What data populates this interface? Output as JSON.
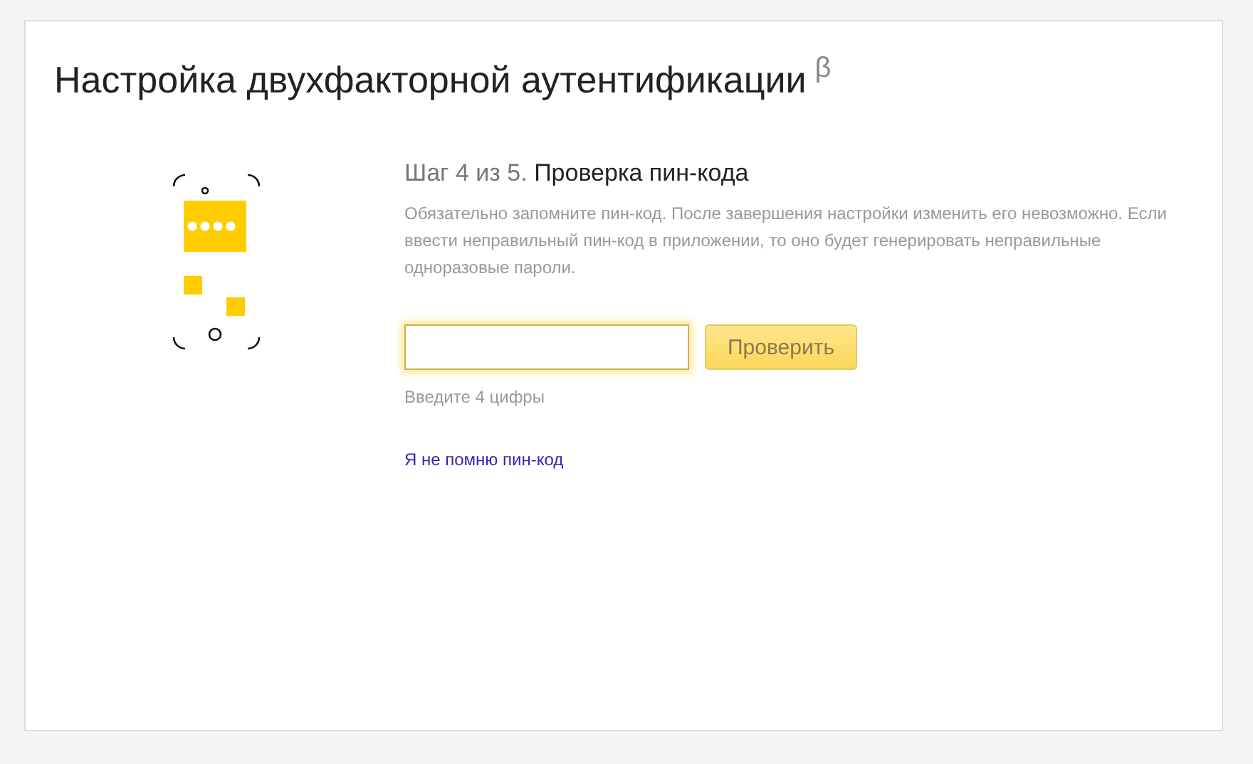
{
  "title": "Настройка двухфакторной аутентификации",
  "title_mark": "β",
  "step": {
    "number": "Шаг 4 из 5.",
    "name": "Проверка пин-кода"
  },
  "description": "Обязательно запомните пин-код. После завершения настройки изменить его невозможно. Если ввести неправильный пин-код в приложении, то оно будет генерировать неправильные одноразовые пароли.",
  "pin_field": {
    "focused": true
  },
  "check_button": {
    "label": "Проверить"
  },
  "hint": "Введите 4 цифры",
  "forgot_link": "Я не помню пин-код"
}
